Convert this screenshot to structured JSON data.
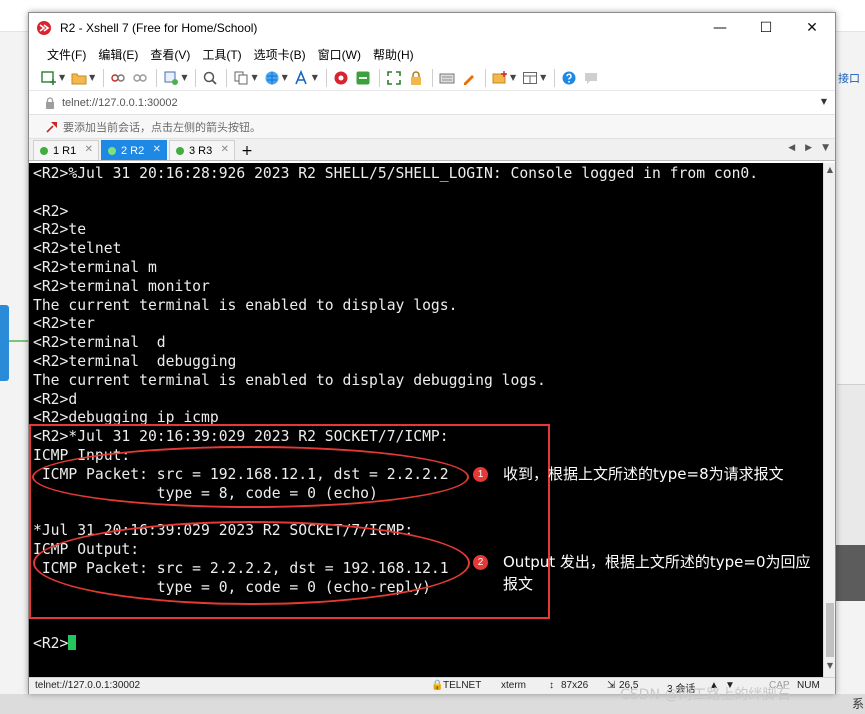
{
  "window": {
    "title": "R2 - Xshell 7 (Free for Home/School)",
    "controls": {
      "minimize": "—",
      "maximize": "☐",
      "close": "✕"
    }
  },
  "menu": [
    "文件(F)",
    "编辑(E)",
    "查看(V)",
    "工具(T)",
    "选项卡(B)",
    "窗口(W)",
    "帮助(H)"
  ],
  "address": {
    "text": "telnet://127.0.0.1:30002"
  },
  "hint": {
    "text": "要添加当前会话，点击左侧的箭头按钮。"
  },
  "tabs": [
    {
      "label": "1 R1",
      "active": false
    },
    {
      "label": "2 R2",
      "active": true
    },
    {
      "label": "3 R3",
      "active": false
    }
  ],
  "tab_add": "+",
  "terminal": {
    "lines": [
      "<R2>%Jul 31 20:16:28:926 2023 R2 SHELL/5/SHELL_LOGIN: Console logged in from con0.",
      "",
      "<R2>",
      "<R2>te",
      "<R2>telnet",
      "<R2>terminal m",
      "<R2>terminal monitor",
      "The current terminal is enabled to display logs.",
      "<R2>ter",
      "<R2>terminal  d",
      "<R2>terminal  debugging",
      "The current terminal is enabled to display debugging logs.",
      "<R2>d",
      "<R2>debugging ip icmp",
      "<R2>*Jul 31 20:16:39:029 2023 R2 SOCKET/7/ICMP:",
      "ICMP Input:",
      " ICMP Packet: src = 192.168.12.1, dst = 2.2.2.2",
      "              type = 8, code = 0 (echo)",
      "",
      "*Jul 31 20:16:39:029 2023 R2 SOCKET/7/ICMP:",
      "ICMP Output:",
      " ICMP Packet: src = 2.2.2.2, dst = 192.168.12.1",
      "              type = 0, code = 0 (echo-reply)",
      "",
      "",
      "<R2>"
    ]
  },
  "annotations": [
    {
      "num": "1",
      "text": "收到，根据上文所述的type=8为请求报文"
    },
    {
      "num": "2",
      "text": "Output 发出，根据上文所述的type=0为回应报文"
    }
  ],
  "status": {
    "address": "telnet://127.0.0.1:30002",
    "protocol": "TELNET",
    "term": "xterm",
    "size": "87x26",
    "cursor": "26,5",
    "sessions": "3 会话",
    "cap": "CAP",
    "num": "NUM"
  },
  "background": {
    "right_link": "接口",
    "bottom_char": "系"
  },
  "watermark": "CSDN @网工路上的绊脚石",
  "colors": {
    "accent": "#1e88e5",
    "annotation": "#e53935",
    "cursor": "#22c55e",
    "terminal_bg": "#000000",
    "terminal_fg": "#ededed"
  }
}
